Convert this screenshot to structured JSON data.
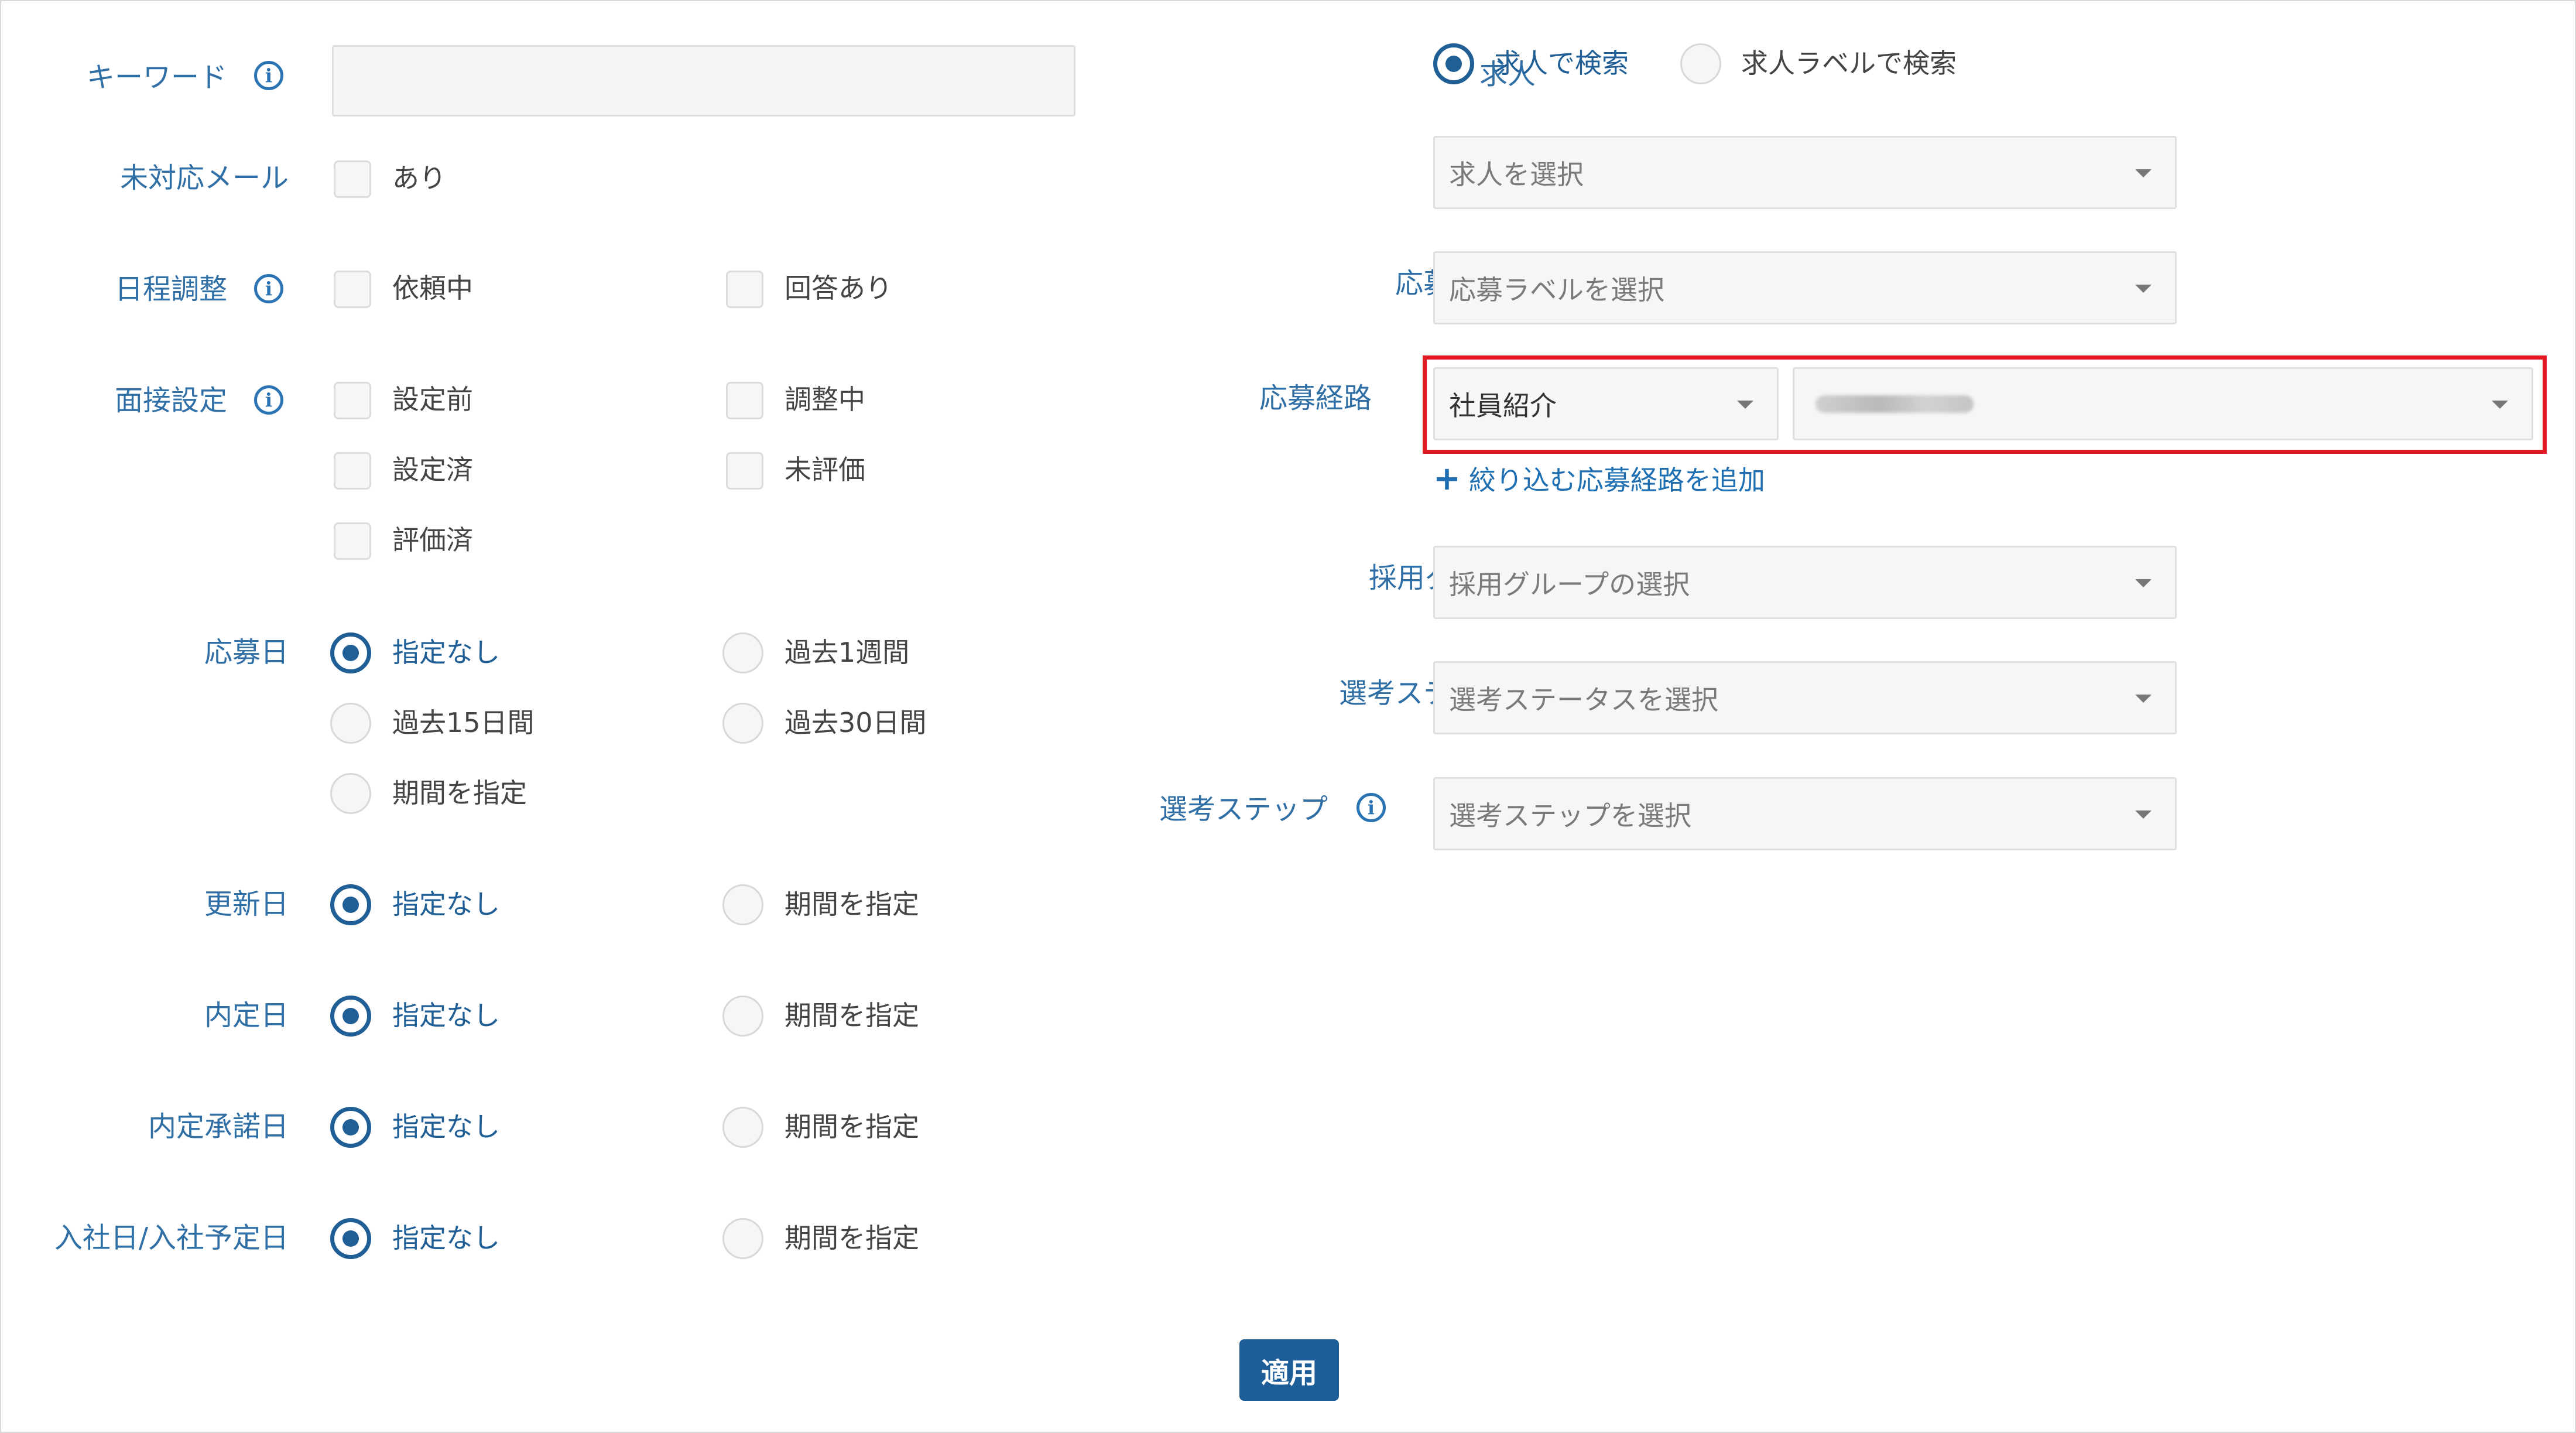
{
  "left": {
    "keyword": {
      "label": "キーワード",
      "value": "",
      "placeholder": ""
    },
    "unread_mail": {
      "label": "未対応メール",
      "options": [
        "あり"
      ]
    },
    "schedule": {
      "label": "日程調整",
      "options": [
        "依頼中",
        "回答あり"
      ]
    },
    "interview": {
      "label": "面接設定",
      "options": [
        "設定前",
        "調整中",
        "設定済",
        "未評価",
        "評価済"
      ]
    },
    "applied_date": {
      "label": "応募日",
      "options": [
        "指定なし",
        "過去1週間",
        "過去15日間",
        "過去30日間",
        "期間を指定"
      ],
      "selected": "指定なし"
    },
    "updated_date": {
      "label": "更新日",
      "options": [
        "指定なし",
        "期間を指定"
      ],
      "selected": "指定なし"
    },
    "offer_date": {
      "label": "内定日",
      "options": [
        "指定なし",
        "期間を指定"
      ],
      "selected": "指定なし"
    },
    "offer_accept_date": {
      "label": "内定承諾日",
      "options": [
        "指定なし",
        "期間を指定"
      ],
      "selected": "指定なし"
    },
    "join_date": {
      "label": "入社日/入社予定日",
      "options": [
        "指定なし",
        "期間を指定"
      ],
      "selected": "指定なし"
    }
  },
  "right": {
    "job": {
      "label": "求人",
      "modes": [
        "求人で検索",
        "求人ラベルで検索"
      ],
      "selected_mode": "求人で検索",
      "placeholder": "求人を選択"
    },
    "application_label": {
      "label": "応募ラベル",
      "placeholder": "応募ラベルを選択"
    },
    "application_route": {
      "label": "応募経路",
      "value": "社員紹介",
      "sub_value_redacted": true,
      "add_link": "絞り込む応募経路を追加"
    },
    "recruit_group": {
      "label": "採用グループ",
      "placeholder": "採用グループの選択"
    },
    "selection_status": {
      "label": "選考ステータス",
      "placeholder": "選考ステータスを選択"
    },
    "selection_step": {
      "label": "選考ステップ",
      "placeholder": "選考ステップを選択"
    }
  },
  "apply_button": "適用",
  "colors": {
    "accent": "#1f5f96",
    "label": "#2f6fa5",
    "highlight": "#e01b24"
  },
  "icons": {
    "info": "info-circle-icon",
    "caret": "caret-down-icon",
    "add": "plus-icon"
  }
}
